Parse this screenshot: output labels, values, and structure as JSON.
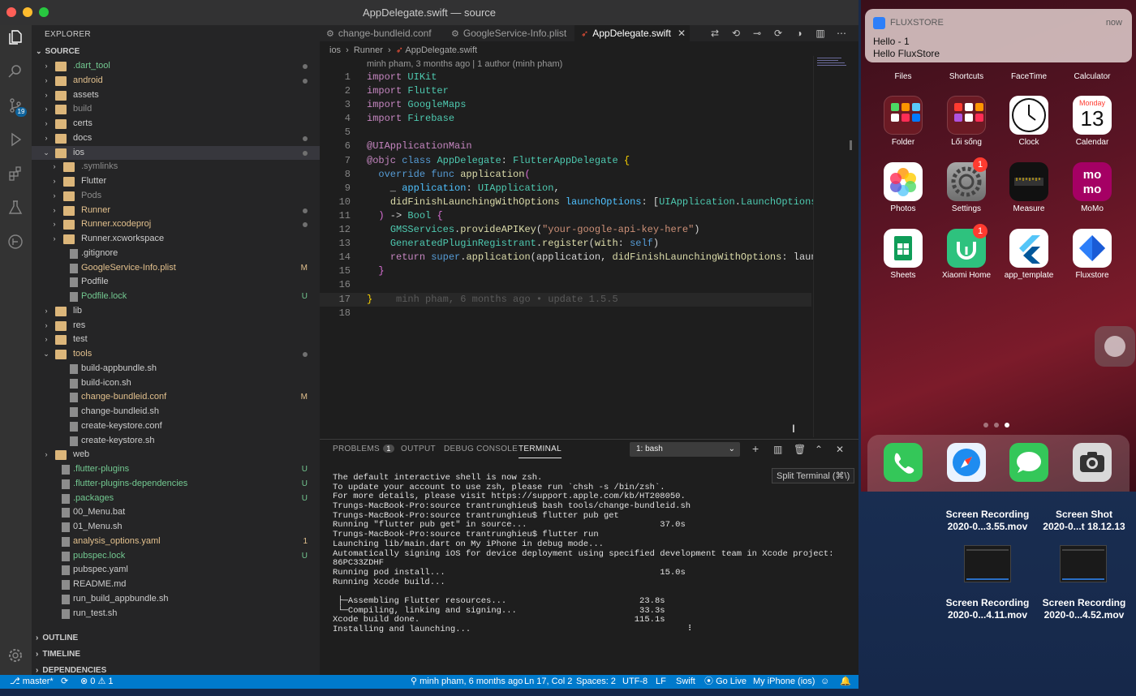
{
  "window": {
    "title": "AppDelegate.swift — source"
  },
  "activity": {
    "scm_badge": "19"
  },
  "sidebar": {
    "title": "EXPLORER",
    "root": "SOURCE",
    "items": [
      {
        "name": ".dart_tool",
        "indent": 0,
        "kind": "folder",
        "chev": "›",
        "color": "#73c991",
        "status": "dot"
      },
      {
        "name": "android",
        "indent": 0,
        "kind": "folder",
        "chev": "›",
        "color": "#e2c08d",
        "status": "dot"
      },
      {
        "name": "assets",
        "indent": 0,
        "kind": "folder",
        "chev": "›",
        "color": "#cccccc",
        "status": ""
      },
      {
        "name": "build",
        "indent": 0,
        "kind": "folder",
        "chev": "›",
        "color": "#8c8c8c",
        "status": ""
      },
      {
        "name": "certs",
        "indent": 0,
        "kind": "folder",
        "chev": "›",
        "color": "#cccccc",
        "status": ""
      },
      {
        "name": "docs",
        "indent": 0,
        "kind": "folder",
        "chev": "›",
        "color": "#cccccc",
        "status": "dot"
      },
      {
        "name": "ios",
        "indent": 0,
        "kind": "folder",
        "chev": "⌄",
        "color": "#cccccc",
        "status": "dot",
        "sel": true
      },
      {
        "name": ".symlinks",
        "indent": 1,
        "kind": "folder",
        "chev": "›",
        "color": "#8c8c8c",
        "status": ""
      },
      {
        "name": "Flutter",
        "indent": 1,
        "kind": "folder",
        "chev": "›",
        "color": "#cccccc",
        "status": ""
      },
      {
        "name": "Pods",
        "indent": 1,
        "kind": "folder",
        "chev": "›",
        "color": "#8c8c8c",
        "status": ""
      },
      {
        "name": "Runner",
        "indent": 1,
        "kind": "folder",
        "chev": "›",
        "color": "#e2c08d",
        "status": "dot"
      },
      {
        "name": "Runner.xcodeproj",
        "indent": 1,
        "kind": "folder",
        "chev": "›",
        "color": "#e2c08d",
        "status": "dot"
      },
      {
        "name": "Runner.xcworkspace",
        "indent": 1,
        "kind": "folder",
        "chev": "›",
        "color": "#cccccc",
        "status": ""
      },
      {
        "name": ".gitignore",
        "indent": 1,
        "kind": "file",
        "chev": "",
        "color": "#cccccc",
        "status": ""
      },
      {
        "name": "GoogleService-Info.plist",
        "indent": 1,
        "kind": "file",
        "chev": "",
        "color": "#e2c08d",
        "status": "M"
      },
      {
        "name": "Podfile",
        "indent": 1,
        "kind": "file",
        "chev": "",
        "color": "#cccccc",
        "status": ""
      },
      {
        "name": "Podfile.lock",
        "indent": 1,
        "kind": "file",
        "chev": "",
        "color": "#73c991",
        "status": "U"
      },
      {
        "name": "lib",
        "indent": 0,
        "kind": "folder",
        "chev": "›",
        "color": "#cccccc",
        "status": ""
      },
      {
        "name": "res",
        "indent": 0,
        "kind": "folder",
        "chev": "›",
        "color": "#cccccc",
        "status": ""
      },
      {
        "name": "test",
        "indent": 0,
        "kind": "folder",
        "chev": "›",
        "color": "#cccccc",
        "status": ""
      },
      {
        "name": "tools",
        "indent": 0,
        "kind": "folder",
        "chev": "⌄",
        "color": "#e2c08d",
        "status": "dot"
      },
      {
        "name": "build-appbundle.sh",
        "indent": 1,
        "kind": "file",
        "chev": "",
        "color": "#cccccc",
        "status": ""
      },
      {
        "name": "build-icon.sh",
        "indent": 1,
        "kind": "file",
        "chev": "",
        "color": "#cccccc",
        "status": ""
      },
      {
        "name": "change-bundleid.conf",
        "indent": 1,
        "kind": "file",
        "chev": "",
        "color": "#e2c08d",
        "status": "M"
      },
      {
        "name": "change-bundleid.sh",
        "indent": 1,
        "kind": "file",
        "chev": "",
        "color": "#cccccc",
        "status": ""
      },
      {
        "name": "create-keystore.conf",
        "indent": 1,
        "kind": "file",
        "chev": "",
        "color": "#cccccc",
        "status": ""
      },
      {
        "name": "create-keystore.sh",
        "indent": 1,
        "kind": "file",
        "chev": "",
        "color": "#cccccc",
        "status": ""
      },
      {
        "name": "web",
        "indent": 0,
        "kind": "folder",
        "chev": "›",
        "color": "#cccccc",
        "status": ""
      },
      {
        "name": ".flutter-plugins",
        "indent": 0,
        "kind": "file",
        "chev": "",
        "color": "#73c991",
        "status": "U"
      },
      {
        "name": ".flutter-plugins-dependencies",
        "indent": 0,
        "kind": "file",
        "chev": "",
        "color": "#73c991",
        "status": "U"
      },
      {
        "name": ".packages",
        "indent": 0,
        "kind": "file",
        "chev": "",
        "color": "#73c991",
        "status": "U"
      },
      {
        "name": "00_Menu.bat",
        "indent": 0,
        "kind": "file",
        "chev": "",
        "color": "#cccccc",
        "status": ""
      },
      {
        "name": "01_Menu.sh",
        "indent": 0,
        "kind": "file",
        "chev": "",
        "color": "#cccccc",
        "status": ""
      },
      {
        "name": "analysis_options.yaml",
        "indent": 0,
        "kind": "file",
        "chev": "",
        "color": "#e2c08d",
        "status": "1"
      },
      {
        "name": "pubspec.lock",
        "indent": 0,
        "kind": "file",
        "chev": "",
        "color": "#73c991",
        "status": "U"
      },
      {
        "name": "pubspec.yaml",
        "indent": 0,
        "kind": "file",
        "chev": "",
        "color": "#cccccc",
        "status": ""
      },
      {
        "name": "README.md",
        "indent": 0,
        "kind": "file",
        "chev": "",
        "color": "#cccccc",
        "status": ""
      },
      {
        "name": "run_build_appbundle.sh",
        "indent": 0,
        "kind": "file",
        "chev": "",
        "color": "#cccccc",
        "status": ""
      },
      {
        "name": "run_test.sh",
        "indent": 0,
        "kind": "file",
        "chev": "",
        "color": "#cccccc",
        "status": ""
      }
    ],
    "outline": "OUTLINE",
    "timeline": "TIMELINE",
    "dependencies": "DEPENDENCIES"
  },
  "tabs": [
    {
      "label": "change-bundleid.conf",
      "icon": "⚙"
    },
    {
      "label": "GoogleService-Info.plist",
      "icon": "⚙"
    },
    {
      "label": "AppDelegate.swift",
      "icon": "swift",
      "close": "✕"
    }
  ],
  "breadcrumb": {
    "p1": "ios",
    "p2": "Runner",
    "p3": "AppDelegate.swift"
  },
  "codelens": "minh pham, 3 months ago | 1 author (minh pham)",
  "code": [
    {
      "n": "1",
      "h": "<span class='kw'>import</span> <span class='ty'>UIKit</span>"
    },
    {
      "n": "2",
      "h": "<span class='kw'>import</span> <span class='ty'>Flutter</span>"
    },
    {
      "n": "3",
      "h": "<span class='kw'>import</span> <span class='ty'>GoogleMaps</span>"
    },
    {
      "n": "4",
      "h": "<span class='kw'>import</span> <span class='ty'>Firebase</span>"
    },
    {
      "n": "5",
      "h": ""
    },
    {
      "n": "6",
      "h": "<span class='kw'>@UIApplicationMain</span>"
    },
    {
      "n": "7",
      "h": "<span class='kw'>@objc</span> <span class='kb'>class</span> <span class='ty'>AppDelegate</span>: <span class='ty'>FlutterAppDelegate</span> <span style='color:#ffd700'>{</span>"
    },
    {
      "n": "8",
      "h": "  <span class='kb'>override</span> <span class='kb'>func</span> <span class='fn'>application</span><span style='color:#da70d6'>(</span>"
    },
    {
      "n": "9",
      "h": "    _ <span class='at'>application</span>: <span class='ty'>UIApplication</span>,"
    },
    {
      "n": "10",
      "h": "    <span class='fn'>didFinishLaunchingWithOptions</span> <span class='at'>launchOptions</span>: [<span class='ty'>UIApplication</span>.<span class='ty'>LaunchOptionsKey</span>:"
    },
    {
      "n": "11",
      "h": "  <span style='color:#da70d6'>)</span> -> <span class='ty'>Bool</span> <span style='color:#da70d6'>{</span>"
    },
    {
      "n": "12",
      "h": "    <span class='ty'>GMSServices</span>.<span class='fn'>provideAPIKey</span>(<span class='st2'>\"your-google-api-key-here\"</span>)"
    },
    {
      "n": "13",
      "h": "    <span class='ty'>GeneratedPluginRegistrant</span>.<span class='fn'>register</span>(<span class='fn'>with</span>: <span class='kb'>self</span>)"
    },
    {
      "n": "14",
      "h": "    <span class='kw'>return</span> <span class='kb'>super</span>.<span class='fn'>application</span>(application, <span class='fn'>didFinishLaunchingWithOptions</span>: launchOp"
    },
    {
      "n": "15",
      "h": "  <span style='color:#da70d6'>}</span>"
    },
    {
      "n": "16",
      "h": ""
    },
    {
      "n": "17",
      "h": "<span style='color:#ffd700'>}</span>    <span class='blame'>minh pham, 6 months ago • update 1.5.5</span>"
    },
    {
      "n": "18",
      "h": ""
    }
  ],
  "panel": {
    "tabs": [
      "PROBLEMS",
      "OUTPUT",
      "DEBUG CONSOLE",
      "TERMINAL"
    ],
    "problems_count": "1",
    "terminal_select": "1: bash",
    "lines": [
      "The default interactive shell is now zsh.",
      "To update your account to use zsh, please run `chsh -s /bin/zsh`.",
      "For more details, please visit https://support.apple.com/kb/HT208050.",
      "Trungs-MacBook-Pro:source trantrunghieu$ bash tools/change-bundleid.sh",
      "Trungs-MacBook-Pro:source trantrunghieu$ flutter pub get",
      "Running \"flutter pub get\" in source...                          37.0s",
      "Trungs-MacBook-Pro:source trantrunghieu$ flutter run",
      "Launching lib/main.dart on My iPhone in debug mode...",
      "Automatically signing iOS for device deployment using specified development team in Xcode project:",
      "86PC33ZDHF",
      "Running pod install...                                          15.0s",
      "Running Xcode build...",
      "",
      " ├─Assembling Flutter resources...                          23.8s",
      " └─Compiling, linking and signing...                        33.3s",
      "Xcode build done.                                          115.1s",
      "Installing and launching...                                          ⠸"
    ]
  },
  "tooltip": "Split Terminal (⌘\\)",
  "status": {
    "branch": "master*",
    "sync": "⟳",
    "errors": "0",
    "warnings": "1",
    "blame": "minh pham, 6 months ago",
    "position": "Ln 17, Col 2",
    "spaces": "Spaces: 2",
    "encoding": "UTF-8",
    "eol": "LF",
    "language": "Swift",
    "golive": "Go Live",
    "device": "My iPhone (ios)"
  },
  "phone": {
    "notification": {
      "app": "FLUXSTORE",
      "time": "now",
      "title": "Hello - 1",
      "body": "Hello FluxStore"
    },
    "row0": [
      "Files",
      "Shortcuts",
      "FaceTime",
      "Calculator"
    ],
    "apps": [
      {
        "label": "Folder"
      },
      {
        "label": "Lối sống"
      },
      {
        "label": "Clock"
      },
      {
        "label": "Calendar",
        "day": "Monday",
        "date": "13"
      },
      {
        "label": "Photos"
      },
      {
        "label": "Settings",
        "badge": "1"
      },
      {
        "label": "Measure"
      },
      {
        "label": "MoMo"
      },
      {
        "label": "Sheets"
      },
      {
        "label": "Xiaomi Home",
        "badge": "1"
      },
      {
        "label": "app_template"
      },
      {
        "label": "Fluxstore"
      }
    ]
  },
  "desktop": [
    {
      "l1": "Screen Recording",
      "l2": "2020-0...3.55.mov"
    },
    {
      "l1": "Screen Shot",
      "l2": "2020-0...t 18.12.13"
    },
    {
      "l1": "Screen Recording",
      "l2": "2020-0...4.11.mov"
    },
    {
      "l1": "Screen Recording",
      "l2": "2020-0...4.52.mov"
    }
  ]
}
